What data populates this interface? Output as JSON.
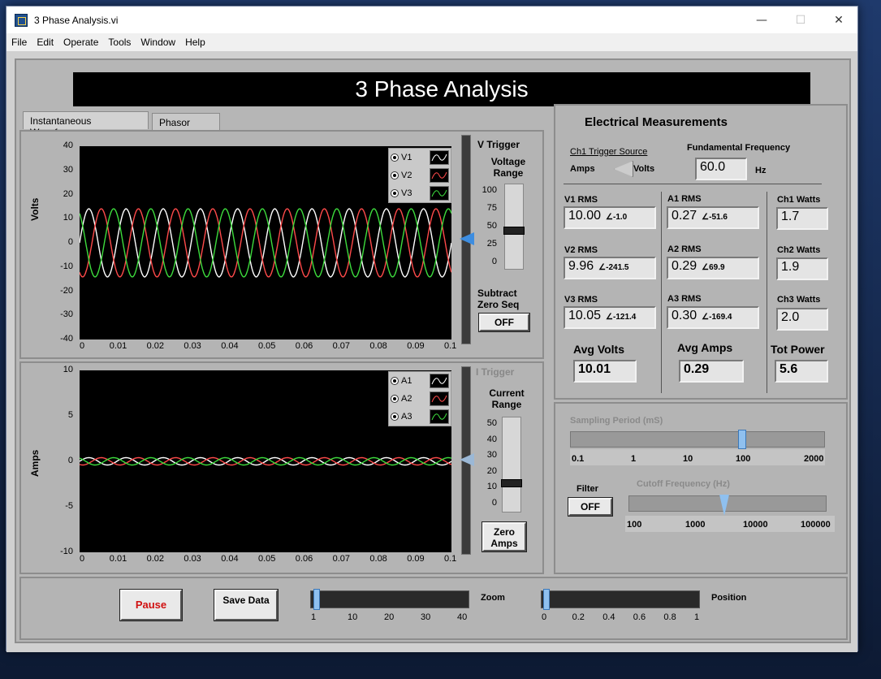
{
  "window": {
    "title": "3 Phase Analysis.vi",
    "minimize": "—",
    "maximize": "☐",
    "close": "✕"
  },
  "menu": [
    "File",
    "Edit",
    "Operate",
    "Tools",
    "Window",
    "Help"
  ],
  "banner": "3 Phase Analysis",
  "tabs": [
    {
      "label": "Instantaneous Waveforms",
      "active": true
    },
    {
      "label": "Phasor View",
      "active": false
    }
  ],
  "volts_graph": {
    "ylabel": "Volts",
    "yticks": [
      "40",
      "30",
      "20",
      "10",
      "0",
      "-10",
      "-20",
      "-30",
      "-40"
    ],
    "xticks": [
      "0",
      "0.01",
      "0.02",
      "0.03",
      "0.04",
      "0.05",
      "0.06",
      "0.07",
      "0.08",
      "0.09",
      "0.1"
    ],
    "legend": [
      "V1",
      "V2",
      "V3"
    ]
  },
  "amps_graph": {
    "ylabel": "Amps",
    "yticks": [
      "10",
      "5",
      "0",
      "-5",
      "-10"
    ],
    "xticks": [
      "0",
      "0.01",
      "0.02",
      "0.03",
      "0.04",
      "0.05",
      "0.06",
      "0.07",
      "0.08",
      "0.09",
      "0.1"
    ],
    "legend": [
      "A1",
      "A2",
      "A3"
    ]
  },
  "chart_data": [
    {
      "type": "line",
      "ylabel": "Volts",
      "xlim": [
        0,
        0.1
      ],
      "ylim": [
        -40,
        40
      ],
      "series": [
        {
          "name": "V1",
          "color": "#ffffff",
          "amplitude": 14.1,
          "phase_deg": 0
        },
        {
          "name": "V2",
          "color": "#ff4a4a",
          "amplitude": 14.1,
          "phase_deg": -120
        },
        {
          "name": "V3",
          "color": "#3ddc3d",
          "amplitude": 14.1,
          "phase_deg": 120
        }
      ],
      "cycles": 10
    },
    {
      "type": "line",
      "ylabel": "Amps",
      "xlim": [
        0,
        0.1
      ],
      "ylim": [
        -10,
        10
      ],
      "series": [
        {
          "name": "A1",
          "color": "#ffffff",
          "amplitude": 0.4,
          "phase_deg": 0
        },
        {
          "name": "A2",
          "color": "#ff4a4a",
          "amplitude": 0.4,
          "phase_deg": -120
        },
        {
          "name": "A3",
          "color": "#3ddc3d",
          "amplitude": 0.4,
          "phase_deg": 120
        }
      ],
      "cycles": 10
    }
  ],
  "v_trigger": {
    "title": "V Trigger",
    "range_label": "Voltage Range",
    "scale": [
      "100",
      "75",
      "50",
      "25",
      "0"
    ],
    "subtract_label": "Subtract Zero Seq",
    "subtract_btn": "OFF"
  },
  "i_trigger": {
    "title": "I Trigger",
    "range_label": "Current Range",
    "scale": [
      "50",
      "40",
      "30",
      "20",
      "10",
      "0"
    ],
    "zero_btn": "Zero Amps"
  },
  "measurements": {
    "title": "Electrical Measurements",
    "trigger_source_label": "Ch1 Trigger Source",
    "trigger_amps": "Amps",
    "trigger_volts": "Volts",
    "fund_freq_label": "Fundamental Frequency",
    "fund_freq_value": "60.0",
    "fund_freq_unit": "Hz",
    "v1_label": "V1 RMS",
    "v1_value": "10.00",
    "v1_angle": "-1.0",
    "v2_label": "V2 RMS",
    "v2_value": "9.96",
    "v2_angle": "-241.5",
    "v3_label": "V3 RMS",
    "v3_value": "10.05",
    "v3_angle": "-121.4",
    "a1_label": "A1 RMS",
    "a1_value": "0.27",
    "a1_angle": "-51.6",
    "a2_label": "A2 RMS",
    "a2_value": "0.29",
    "a2_angle": "69.9",
    "a3_label": "A3 RMS",
    "a3_value": "0.30",
    "a3_angle": "-169.4",
    "w1_label": "Ch1 Watts",
    "w1_value": "1.7",
    "w2_label": "Ch2 Watts",
    "w2_value": "1.9",
    "w3_label": "Ch3 Watts",
    "w3_value": "2.0",
    "avg_volts_label": "Avg Volts",
    "avg_volts_value": "10.01",
    "avg_amps_label": "Avg Amps",
    "avg_amps_value": "0.29",
    "tot_power_label": "Tot Power",
    "tot_power_value": "5.6"
  },
  "sampling": {
    "label": "Sampling Period (mS)",
    "scale": [
      "0.1",
      "1",
      "10",
      "100",
      "2000"
    ],
    "value": 100
  },
  "filter": {
    "label": "Filter",
    "btn": "OFF",
    "cutoff_label": "Cutoff Frequency (Hz)",
    "scale": [
      "100",
      "1000",
      "10000",
      "100000"
    ],
    "value": 3000
  },
  "bottom": {
    "pause": "Pause",
    "save": "Save Data",
    "zoom_label": "Zoom",
    "zoom_scale": [
      "1",
      "10",
      "20",
      "30",
      "40"
    ],
    "zoom_value": 1,
    "position_label": "Position",
    "position_scale": [
      "0",
      "0.2",
      "0.4",
      "0.6",
      "0.8",
      "1"
    ],
    "position_value": 0
  }
}
